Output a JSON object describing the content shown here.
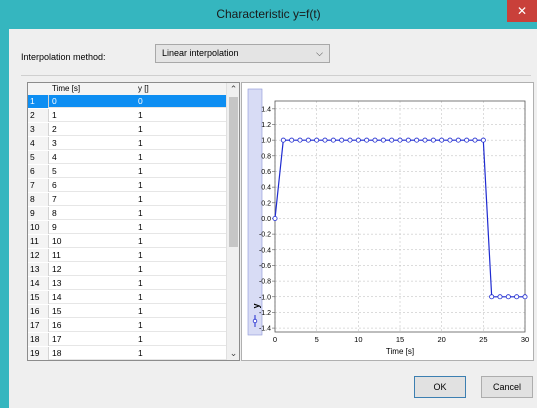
{
  "window": {
    "title": "Characteristic y=f(t)",
    "close_glyph": "✕"
  },
  "interpolation": {
    "label": "Interpolation method:",
    "selected": "Linear interpolation",
    "arrow_glyph": "⌵"
  },
  "table": {
    "columns": [
      "Time [s]",
      "y []"
    ],
    "selected_row": 0,
    "rows": [
      {
        "n": "1",
        "t": "0",
        "y": "0"
      },
      {
        "n": "2",
        "t": "1",
        "y": "1"
      },
      {
        "n": "3",
        "t": "2",
        "y": "1"
      },
      {
        "n": "4",
        "t": "3",
        "y": "1"
      },
      {
        "n": "5",
        "t": "4",
        "y": "1"
      },
      {
        "n": "6",
        "t": "5",
        "y": "1"
      },
      {
        "n": "7",
        "t": "6",
        "y": "1"
      },
      {
        "n": "8",
        "t": "7",
        "y": "1"
      },
      {
        "n": "9",
        "t": "8",
        "y": "1"
      },
      {
        "n": "10",
        "t": "9",
        "y": "1"
      },
      {
        "n": "11",
        "t": "10",
        "y": "1"
      },
      {
        "n": "12",
        "t": "11",
        "y": "1"
      },
      {
        "n": "13",
        "t": "12",
        "y": "1"
      },
      {
        "n": "14",
        "t": "13",
        "y": "1"
      },
      {
        "n": "15",
        "t": "14",
        "y": "1"
      },
      {
        "n": "16",
        "t": "15",
        "y": "1"
      },
      {
        "n": "17",
        "t": "16",
        "y": "1"
      },
      {
        "n": "18",
        "t": "17",
        "y": "1"
      },
      {
        "n": "19",
        "t": "18",
        "y": "1"
      }
    ],
    "scroll_up_glyph": "⌃",
    "scroll_down_glyph": "⌄"
  },
  "chart_data": {
    "type": "line",
    "xlabel": "Time [s]",
    "ylabel": "y",
    "xlim": [
      0,
      30
    ],
    "ylim": [
      -1.45,
      1.5
    ],
    "xticks": [
      0,
      5,
      10,
      15,
      20,
      25,
      30
    ],
    "yticks": [
      1.4,
      1.2,
      1.0,
      0.8,
      0.6,
      0.4,
      0.2,
      0.0,
      -0.2,
      -0.4,
      -0.6,
      -0.8,
      -1.0,
      -1.2,
      -1.4
    ],
    "grid": true,
    "line_color": "#1f2bd0",
    "series": [
      {
        "x": [
          0,
          1,
          2,
          3,
          4,
          5,
          6,
          7,
          8,
          9,
          10,
          11,
          12,
          13,
          14,
          15,
          16,
          17,
          18,
          19,
          20,
          21,
          22,
          23,
          24,
          25,
          26,
          27,
          28,
          29,
          30
        ],
        "y": [
          0,
          1,
          1,
          1,
          1,
          1,
          1,
          1,
          1,
          1,
          1,
          1,
          1,
          1,
          1,
          1,
          1,
          1,
          1,
          1,
          1,
          1,
          1,
          1,
          1,
          1,
          -1,
          -1,
          -1,
          -1,
          -1
        ]
      }
    ]
  },
  "buttons": {
    "ok": "OK",
    "cancel": "Cancel"
  }
}
